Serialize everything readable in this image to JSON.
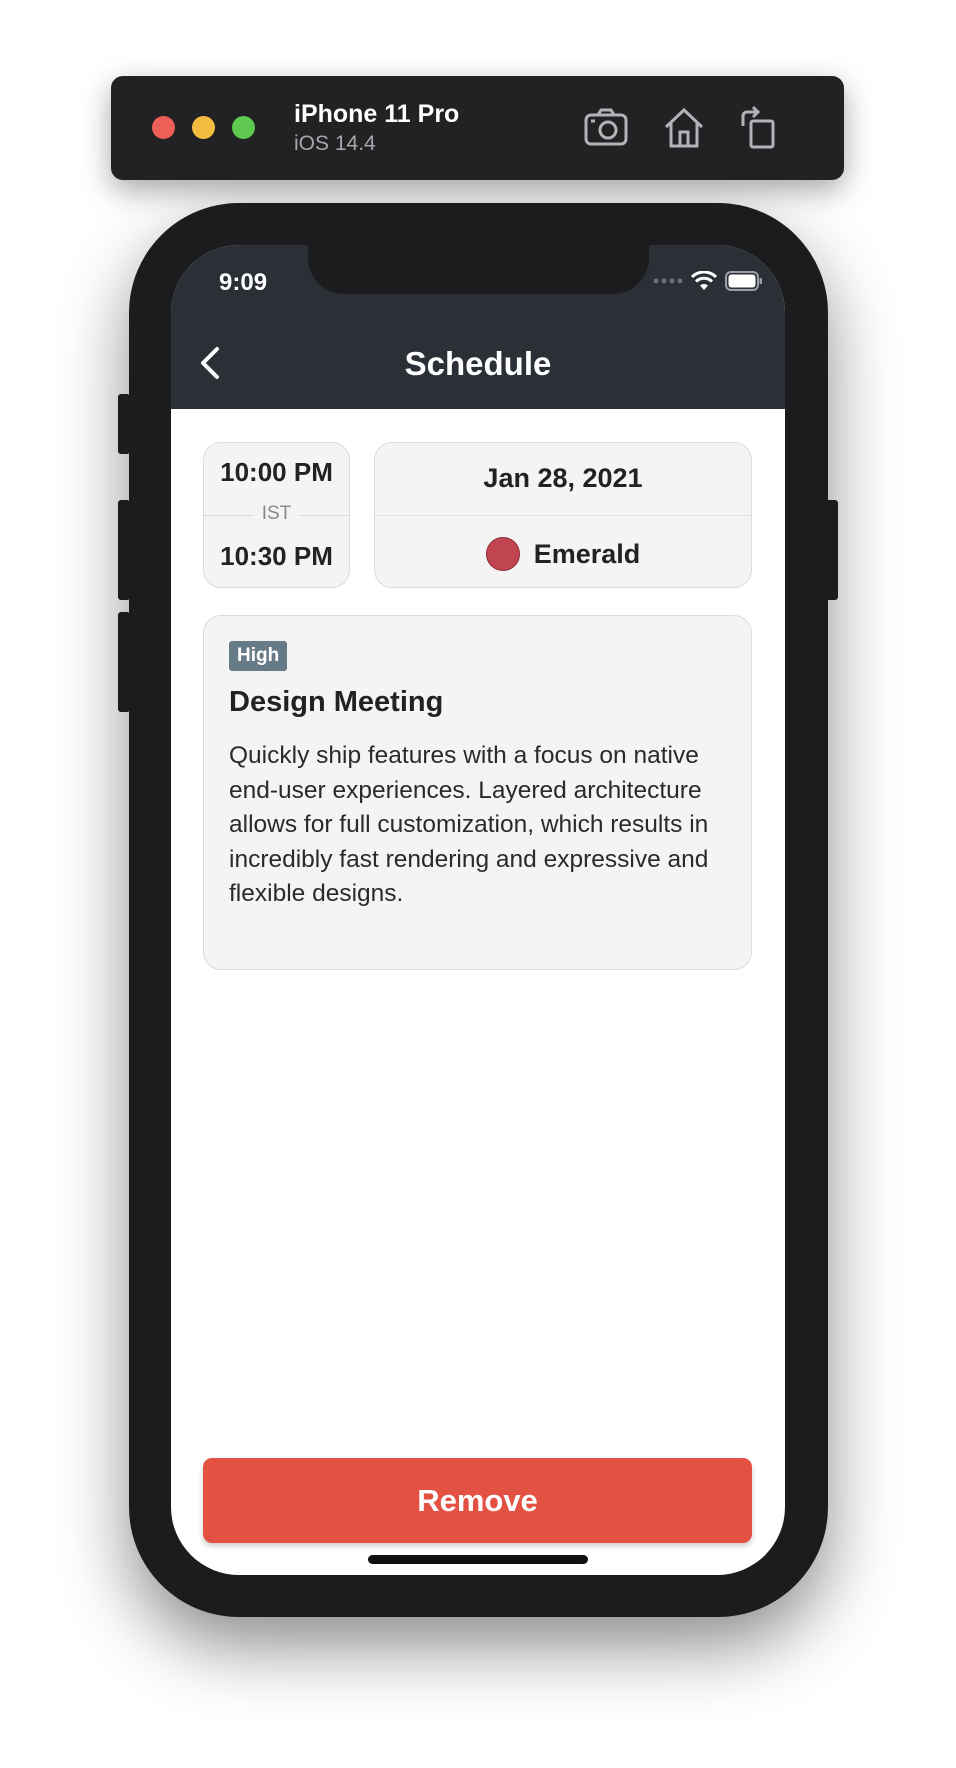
{
  "simulator": {
    "device_name": "iPhone 11 Pro",
    "os_version": "iOS 14.4",
    "icons": [
      "screenshot-icon",
      "home-icon",
      "rotate-icon"
    ]
  },
  "status_bar": {
    "time": "9:09",
    "icons": [
      "signal-icon",
      "wifi-icon",
      "battery-icon"
    ]
  },
  "nav": {
    "title": "Schedule",
    "back_icon": "chevron-left-icon"
  },
  "time_range": {
    "start": "10:00 PM",
    "timezone": "IST",
    "end": "10:30 PM"
  },
  "booking": {
    "date": "Jan 28, 2021",
    "room": "Emerald",
    "room_color": "#c14451"
  },
  "event": {
    "priority": "High",
    "title": "Design Meeting",
    "description": "Quickly ship features with a focus on native end-user experiences. Layered architecture allows for full customization, which results in incredibly fast rendering and expressive and flexible designs."
  },
  "actions": {
    "remove_label": "Remove"
  },
  "colors": {
    "nav_bar": "#2a3036",
    "badge": "#667b87",
    "remove_button": "#e35143"
  }
}
